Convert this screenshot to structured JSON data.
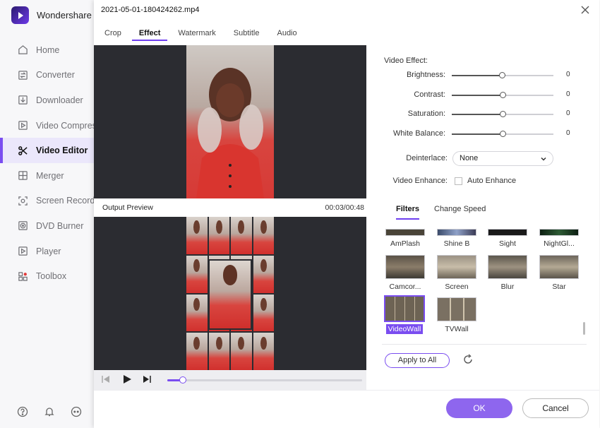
{
  "app": {
    "brand_name": "Wondershare U",
    "nav": [
      {
        "label": "Home",
        "icon": "home-icon"
      },
      {
        "label": "Converter",
        "icon": "converter-icon"
      },
      {
        "label": "Downloader",
        "icon": "downloader-icon"
      },
      {
        "label": "Video Compress",
        "icon": "video-compress-icon"
      },
      {
        "label": "Video Editor",
        "icon": "scissors-icon",
        "active": true
      },
      {
        "label": "Merger",
        "icon": "merger-icon"
      },
      {
        "label": "Screen Recorder",
        "icon": "screen-recorder-icon"
      },
      {
        "label": "DVD Burner",
        "icon": "dvd-icon"
      },
      {
        "label": "Player",
        "icon": "player-icon"
      },
      {
        "label": "Toolbox",
        "icon": "toolbox-icon"
      }
    ],
    "bottom_icons": [
      "help-icon",
      "bell-icon",
      "feedback-icon"
    ],
    "accent": "#7a4df0"
  },
  "dialog": {
    "title": "2021-05-01-180424262.mp4",
    "tabs": [
      "Crop",
      "Effect",
      "Watermark",
      "Subtitle",
      "Audio"
    ],
    "active_tab": "Effect",
    "preview": {
      "output_label": "Output Preview",
      "time": "00:03/00:48",
      "progress": 0.08
    },
    "video_effect": {
      "title": "Video Effect:",
      "sliders": [
        {
          "label": "Brightness:",
          "value": "0",
          "level": 0.5
        },
        {
          "label": "Contrast:",
          "value": "0",
          "level": 0.51
        },
        {
          "label": "Saturation:",
          "value": "0",
          "level": 0.51
        },
        {
          "label": "White Balance:",
          "value": "0",
          "level": 0.51
        }
      ],
      "deinterlace_label": "Deinterlace:",
      "deinterlace_value": "None",
      "enhance_label": "Video Enhance:",
      "enhance_checkbox_label": "Auto Enhance"
    },
    "filters": {
      "tabs": [
        "Filters",
        "Change Speed"
      ],
      "row1": [
        "AmPlash",
        "Shine B",
        "Sight",
        "NightGl..."
      ],
      "row2": [
        "Camcor...",
        "Screen",
        "Blur",
        "Star"
      ],
      "row3": [
        "VideoWall",
        "TVWall"
      ],
      "selected": "VideoWall",
      "apply_all_label": "Apply to All"
    },
    "ok_label": "OK",
    "cancel_label": "Cancel"
  }
}
